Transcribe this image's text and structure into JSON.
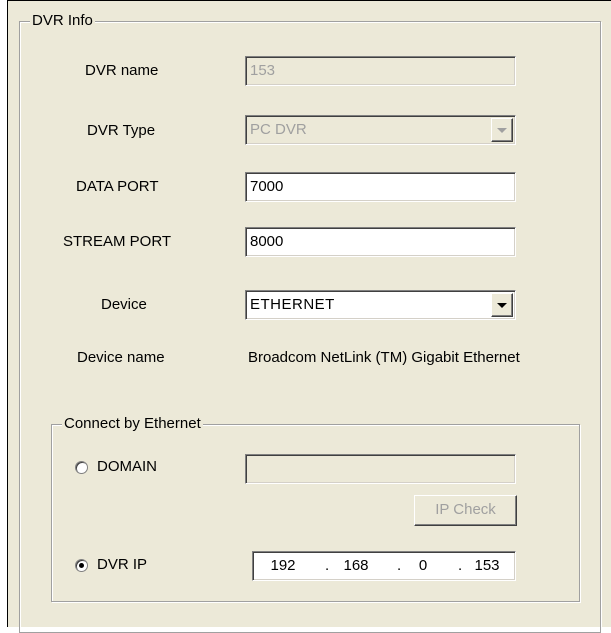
{
  "group": {
    "title": "DVR Info"
  },
  "dvr_name": {
    "label": "DVR name",
    "value": "153"
  },
  "dvr_type": {
    "label": "DVR Type",
    "value": "PC DVR"
  },
  "data_port": {
    "label": "DATA PORT",
    "value": "7000"
  },
  "stream_port": {
    "label": "STREAM PORT",
    "value": "8000"
  },
  "device": {
    "label": "Device",
    "value": "ETHERNET"
  },
  "device_name": {
    "label": "Device name",
    "value": "Broadcom NetLink (TM) Gigabit Ethernet"
  },
  "ethernet": {
    "title": "Connect by Ethernet",
    "domain": {
      "label": "DOMAIN",
      "value": "",
      "selected": false
    },
    "ip_check": {
      "label": "IP Check"
    },
    "dvr_ip": {
      "label": "DVR IP",
      "selected": true,
      "octets": [
        "192",
        "168",
        "0",
        "153"
      ]
    }
  },
  "colors": {
    "dialog_bg": "#ece9d8",
    "disabled_text": "#a0a0a0"
  }
}
